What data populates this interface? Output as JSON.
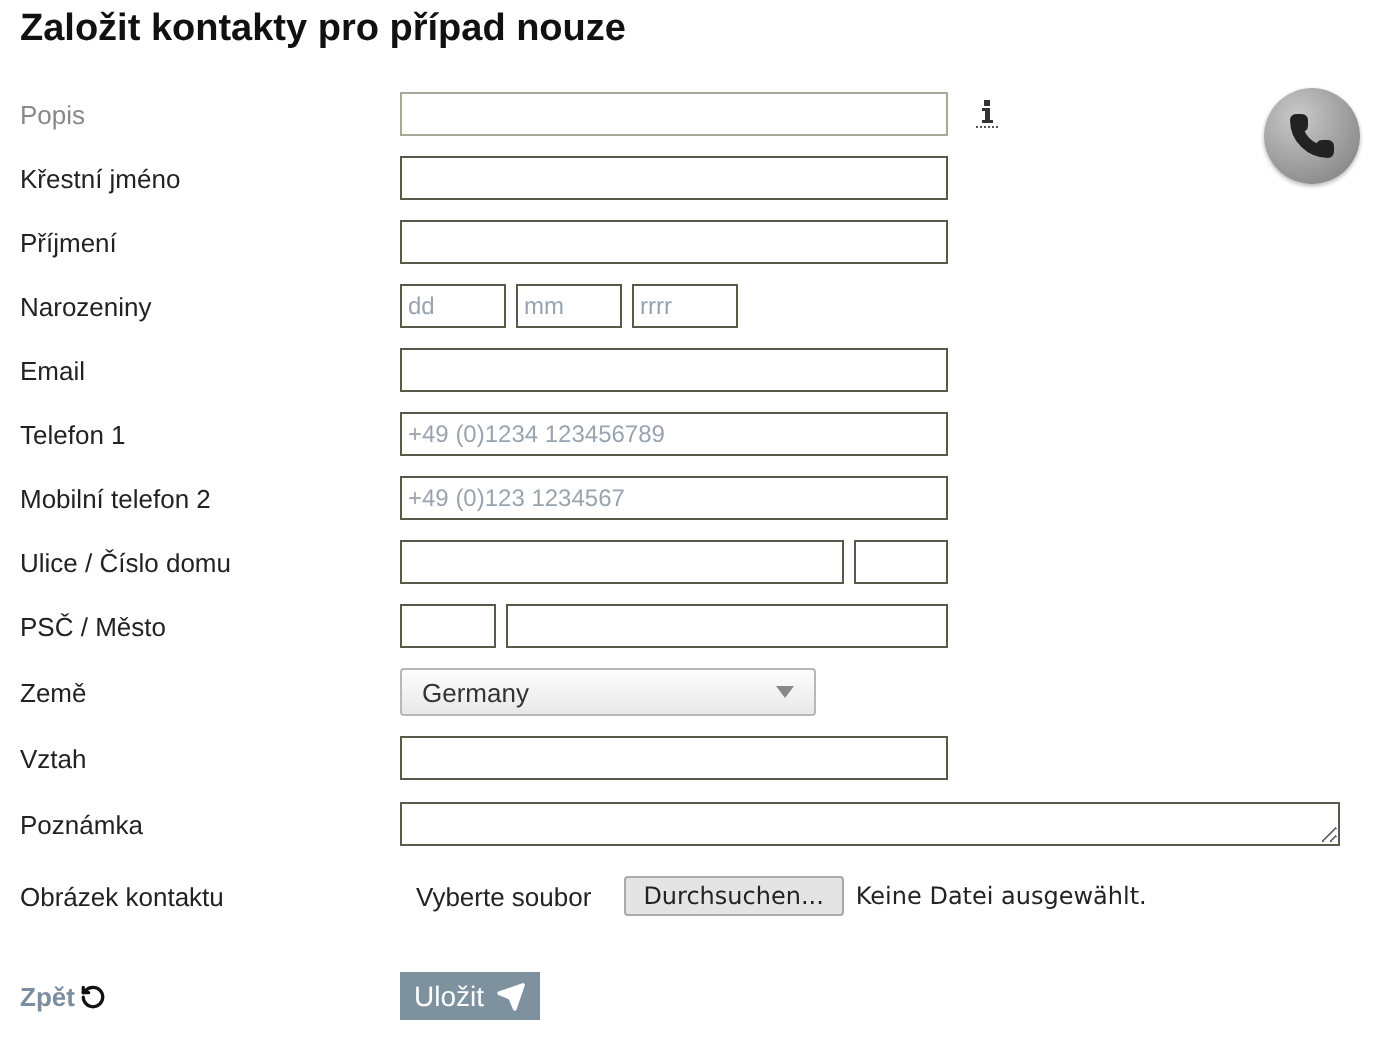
{
  "title": "Založit kontakty pro případ nouze",
  "fields": [
    {
      "kind": "text",
      "label": "Popis",
      "muted": true,
      "info_icon": true
    },
    {
      "kind": "text",
      "label": "Křestní jméno",
      "muted": false
    },
    {
      "kind": "text",
      "label": "Příjmení",
      "muted": false
    },
    {
      "kind": "date",
      "label": "Narozeniny",
      "muted": false,
      "placeholders": [
        "dd",
        "mm",
        "rrrr"
      ]
    },
    {
      "kind": "text",
      "label": "Email",
      "muted": false
    },
    {
      "kind": "text",
      "label": "Telefon 1",
      "muted": false,
      "placeholder": "+49 (0)1234 123456789"
    },
    {
      "kind": "text",
      "label": "Mobilní telefon 2",
      "muted": false,
      "placeholder": "+49 (0)123 1234567"
    },
    {
      "kind": "street",
      "label": "Ulice / Číslo domu",
      "muted": false
    },
    {
      "kind": "city",
      "label": "PSČ / Město",
      "muted": false
    },
    {
      "kind": "select",
      "label": "Země",
      "muted": false,
      "value": "Germany"
    },
    {
      "kind": "text",
      "label": "Vztah",
      "muted": false
    },
    {
      "kind": "textarea",
      "label": "Poznámka",
      "muted": false
    },
    {
      "kind": "file",
      "label": "Obrázek kontaktu",
      "muted": false,
      "prompt": "Vyberte soubor",
      "button": "Durchsuchen...",
      "status": "Keine Datei ausgewählt."
    }
  ],
  "back_link": "Zpět",
  "save_button": "Uložit"
}
